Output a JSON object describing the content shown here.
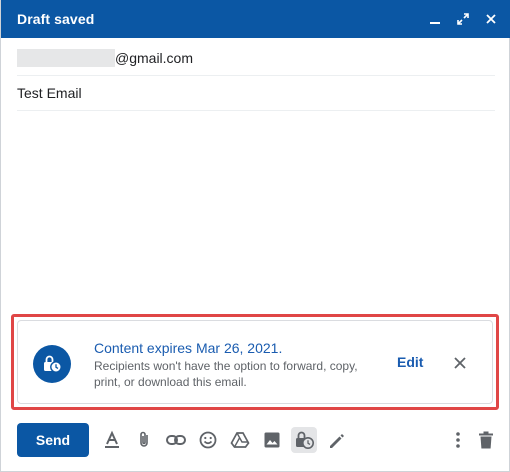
{
  "window": {
    "title": "Draft saved",
    "controls": [
      "minimize-icon",
      "expand-icon",
      "close-icon"
    ]
  },
  "compose": {
    "recipient_domain": "@gmail.com",
    "subject": "Test Email"
  },
  "confidential": {
    "title": "Content expires Mar 26, 2021.",
    "description": "Recipients won't have the option to forward, copy, print, or download this email.",
    "edit_label": "Edit"
  },
  "toolbar": {
    "send_label": "Send",
    "tools": [
      "format-text-icon",
      "attach-icon",
      "link-icon",
      "emoji-icon",
      "drive-icon",
      "photo-icon",
      "confidential-mode-icon",
      "signature-icon",
      "more-options-icon",
      "discard-icon"
    ]
  },
  "colors": {
    "accent": "#0b57a4",
    "link": "#1a5cb0",
    "highlight": "#e04646"
  }
}
